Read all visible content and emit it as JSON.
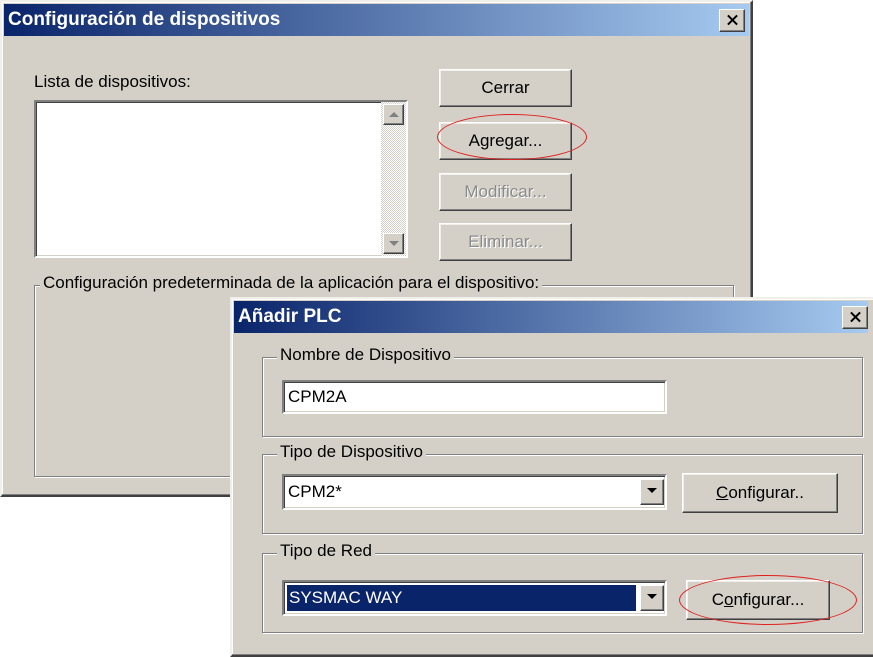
{
  "config_window": {
    "title": "Configuración de dispositivos",
    "list_label": "Lista de dispositivos:",
    "buttons": {
      "close": "Cerrar",
      "add": "Agregar...",
      "modify": "Modificar...",
      "delete": "Eliminar..."
    },
    "default_config_label": "Configuración predeterminada de la aplicación para el dispositivo:"
  },
  "add_plc_window": {
    "title": "Añadir PLC",
    "device_name": {
      "group_label": "Nombre de Dispositivo",
      "value": "CPM2A"
    },
    "device_type": {
      "group_label": "Tipo de Dispositivo",
      "value": "CPM2*",
      "configure_label_mnemonic": "C",
      "configure_label_rest": "onfigurar.."
    },
    "network_type": {
      "group_label": "Tipo de Red",
      "value": "SYSMAC WAY",
      "configure_label_prefix": "C",
      "configure_label_mnemonic": "o",
      "configure_label_rest": "nfigurar..."
    }
  },
  "colors": {
    "titlebar_active": "#0a246a",
    "titlebar_gradient_end": "#a6caf0",
    "window_face": "#d4d0c8",
    "selection": "#0a246a",
    "annotation_oval": "#e02020"
  }
}
